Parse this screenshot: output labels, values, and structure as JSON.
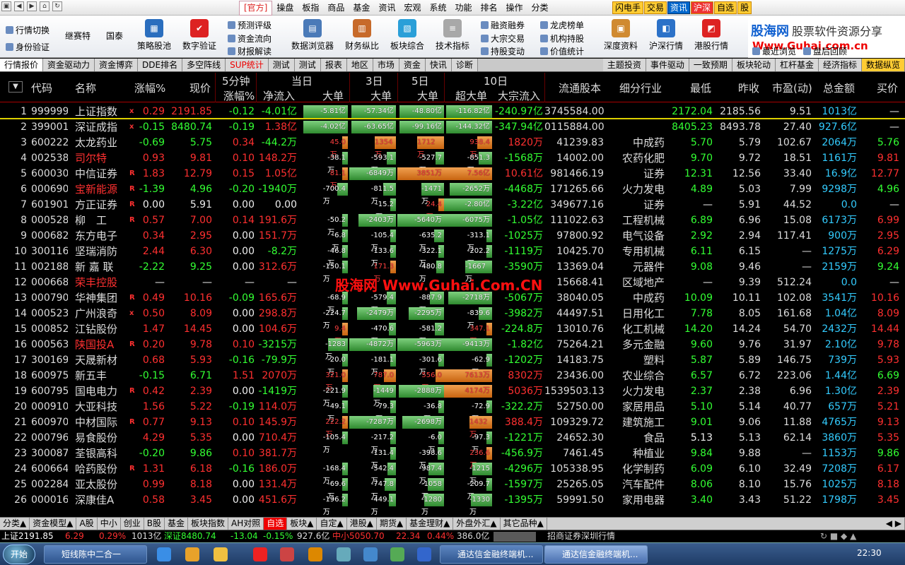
{
  "menu": {
    "official": "[官方]",
    "items": [
      "操盘",
      "板指",
      "商品",
      "基金",
      "资讯",
      "宏观",
      "系统",
      "功能",
      "排名",
      "操作",
      "分类"
    ],
    "right": [
      "闪电手",
      "交易",
      "资讯",
      "沪深",
      "自选",
      "股"
    ]
  },
  "toolbar": {
    "big": [
      "行情切换",
      "身份验证",
      "继赛特",
      "国泰",
      "策略股池",
      "数字验证",
      "数据浏览器",
      "财务纵比",
      "板块综合",
      "技术指标",
      "深度资料",
      "沪深行情",
      "港股行情"
    ],
    "small": [
      "预测评级",
      "资金流向",
      "财报解读",
      "融资融券",
      "大宗交易",
      "持股变动",
      "龙虎榜单",
      "机构持股",
      "价值统计",
      "最近浏览",
      "盘后回顾"
    ]
  },
  "logo": {
    "line1": "股海网",
    "line1b": "股票软件资源分享",
    "line2": "Www.Guhai.com.cn"
  },
  "tabs": [
    "行情报价",
    "资金驱动力",
    "资金博弈",
    "DDE排名",
    "多空阵线",
    "SUP统计",
    "测试",
    "测试",
    "报表",
    "地区",
    "市场",
    "资金",
    "快讯",
    "诊断"
  ],
  "tabs_right": [
    "主题投资",
    "事件驱动",
    "一致预期",
    "板块轮动",
    "杠杆基金",
    "经济指标",
    "数据纵览"
  ],
  "header": {
    "code": "代码",
    "name": "名称",
    "chg": "涨幅%",
    "px": "现价",
    "m5": "5分钟",
    "m5sub": "涨幅%",
    "today": "当日",
    "net": "净流入",
    "big": "大单",
    "d3": "3日",
    "d3big": "大单",
    "d5": "5日",
    "d5big": "大单",
    "d10": "10日",
    "xbig": "超大单",
    "block": "大宗流入",
    "cap": "流通股本",
    "ind": "细分行业",
    "low": "最低",
    "prev": "昨收",
    "pe": "市盈(动)",
    "tot": "总金额",
    "buy": "买价"
  },
  "rows": [
    [
      "1",
      "999999",
      "上证指数",
      "x",
      "0.29",
      "2191.85",
      "-0.12",
      "-4.01亿",
      "-5.81亿",
      "-57.34亿",
      "-48.80亿",
      "-116.82亿",
      "-240.97亿",
      "3745584.00",
      "",
      "2172.04",
      "2185.56",
      "9.51",
      "1013亿",
      "—"
    ],
    [
      "2",
      "399001",
      "深证成指",
      "x",
      "-0.15",
      "8480.74",
      "-0.19",
      "1.38亿",
      "-4.02亿",
      "-63.65亿",
      "-99.16亿",
      "-144.32亿",
      "-347.94亿",
      "0115884.00",
      "",
      "8405.23",
      "8493.78",
      "27.40",
      "927.6亿",
      "—"
    ],
    [
      "3",
      "600222",
      "太龙药业",
      "",
      "-0.69",
      "5.75",
      "0.34",
      "-44.2万",
      "45.0万",
      "1354万",
      "1712万",
      "938.4万",
      "1820万",
      "41239.83",
      "中成药",
      "5.70",
      "5.79",
      "102.67",
      "2064万",
      "5.76"
    ],
    [
      "4",
      "002538",
      "司尔特",
      "",
      "0.93",
      "9.81",
      "0.10",
      "148.2万",
      "-38.1万",
      "-593.1万",
      "-527.7万",
      "-851.3万",
      "-1568万",
      "14002.00",
      "农药化肥",
      "9.70",
      "9.72",
      "18.51",
      "1161万",
      "9.81"
    ],
    [
      "5",
      "600030",
      "中信证券",
      "R",
      "1.83",
      "12.79",
      "0.15",
      "1.05亿",
      "81.1万",
      "-6849万",
      "3851万",
      "7.56亿",
      "10.61亿",
      "981466.19",
      "证券",
      "12.31",
      "12.56",
      "33.40",
      "16.9亿",
      "12.77"
    ],
    [
      "6",
      "000690",
      "宝新能源",
      "R",
      "-1.39",
      "4.96",
      "-0.20",
      "-1940万",
      "-700.4万",
      "-811.5万",
      "-1471万",
      "-2652万",
      "-4468万",
      "171265.66",
      "火力发电",
      "4.89",
      "5.03",
      "7.99",
      "9298万",
      "4.96"
    ],
    [
      "7",
      "601901",
      "方正证券",
      "R",
      "0.00",
      "5.91",
      "0.00",
      "0.00",
      "",
      "-15.2万",
      "24.4万",
      "-2.80亿",
      "-3.22亿",
      "349677.16",
      "证券",
      "—",
      "5.91",
      "44.52",
      "0.0",
      "—"
    ],
    [
      "8",
      "000528",
      "柳　工",
      "R",
      "0.57",
      "7.00",
      "0.14",
      "191.6万",
      "-50.2万",
      "-2403万",
      "-5640万",
      "-6075万",
      "-1.05亿",
      "111022.63",
      "工程机械",
      "6.89",
      "6.96",
      "15.08",
      "6173万",
      "6.99"
    ],
    [
      "9",
      "000682",
      "东方电子",
      "",
      "0.34",
      "2.95",
      "0.00",
      "151.7万",
      "-6.8万",
      "-105.4万",
      "-635.2万",
      "-313.1万",
      "-1025万",
      "97800.92",
      "电气设备",
      "2.92",
      "2.94",
      "117.41",
      "900万",
      "2.95"
    ],
    [
      "10",
      "300116",
      "坚瑞消防",
      "",
      "2.44",
      "6.30",
      "0.00",
      "-8.2万",
      "-46.8万",
      "-133.6万",
      "-322.1万",
      "-202.2万",
      "-1119万",
      "10425.70",
      "专用机械",
      "6.11",
      "6.15",
      "—",
      "1275万",
      "6.29"
    ],
    [
      "11",
      "002188",
      "新 嘉 联",
      "",
      "-2.22",
      "9.25",
      "0.00",
      "312.6万",
      "-150.1万",
      "171.3万",
      "-480.8万",
      "-1667万",
      "-3590万",
      "13369.04",
      "元器件",
      "9.08",
      "9.46",
      "—",
      "2159万",
      "9.24"
    ],
    [
      "12",
      "000668",
      "荣丰控股",
      "",
      "—",
      "—",
      "—",
      "—",
      "",
      "",
      "",
      "",
      "",
      "15668.41",
      "区域地产",
      "—",
      "9.39",
      "512.24",
      "0.0",
      "—"
    ],
    [
      "13",
      "000790",
      "华神集团",
      "R",
      "0.49",
      "10.16",
      "-0.09",
      "165.6万",
      "-68.9万",
      "-579.4万",
      "-887.9万",
      "-2718万",
      "-5067万",
      "38040.05",
      "中成药",
      "10.09",
      "10.11",
      "102.08",
      "3541万",
      "10.16"
    ],
    [
      "14",
      "000523",
      "广州浪奇",
      "x",
      "0.50",
      "8.09",
      "0.00",
      "298.8万",
      "-224.7万",
      "-2479万",
      "-2295万",
      "-839.6万",
      "-3982万",
      "44497.51",
      "日用化工",
      "7.78",
      "8.05",
      "161.68",
      "1.04亿",
      "8.09"
    ],
    [
      "15",
      "000852",
      "江钻股份",
      "",
      "1.47",
      "14.45",
      "0.00",
      "104.6万",
      "9.4万",
      "-470.6万",
      "-581.2万",
      "347.1万",
      "-224.8万",
      "13010.76",
      "化工机械",
      "14.20",
      "14.24",
      "54.70",
      "2432万",
      "14.44"
    ],
    [
      "16",
      "000563",
      "陕国投A",
      "R",
      "0.20",
      "9.78",
      "0.10",
      "-3215万",
      "-1283万",
      "-4872万",
      "-5963万",
      "-9413万",
      "-1.82亿",
      "75264.21",
      "多元金融",
      "9.60",
      "9.76",
      "31.97",
      "2.10亿",
      "9.78"
    ],
    [
      "17",
      "300169",
      "天晟新材",
      "",
      "0.68",
      "5.93",
      "-0.16",
      "-79.9万",
      "-20.0万",
      "-181.1万",
      "-301.6万",
      "-62.9万",
      "-1202万",
      "14183.75",
      "塑料",
      "5.87",
      "5.89",
      "146.75",
      "739万",
      "5.93"
    ],
    [
      "18",
      "600975",
      "新五丰",
      "",
      "-0.15",
      "6.71",
      "1.51",
      "2070万",
      "321.0万",
      "787.0万",
      "556.0万",
      "7613万",
      "8302万",
      "23436.00",
      "农业综合",
      "6.57",
      "6.72",
      "223.06",
      "1.44亿",
      "6.69"
    ],
    [
      "19",
      "600795",
      "国电电力",
      "R",
      "0.42",
      "2.39",
      "0.00",
      "-1419万",
      "-221.9万",
      "-1449万",
      "-2888万",
      "4174万",
      "5036万",
      "1539503.13",
      "火力发电",
      "2.37",
      "2.38",
      "6.96",
      "1.30亿",
      "2.39"
    ],
    [
      "20",
      "000910",
      "大亚科技",
      "",
      "1.56",
      "5.22",
      "-0.19",
      "114.0万",
      "-49.1万",
      "-79.3万",
      "-36.8万",
      "-72.9万",
      "-322.2万",
      "52750.00",
      "家居用品",
      "5.10",
      "5.14",
      "40.77",
      "657万",
      "5.21"
    ],
    [
      "21",
      "600970",
      "中材国际",
      "R",
      "0.77",
      "9.13",
      "0.10",
      "145.9万",
      "222.2万",
      "-7287万",
      "-2698万",
      "1432万",
      "388.4万",
      "109329.72",
      "建筑施工",
      "9.01",
      "9.06",
      "11.88",
      "4765万",
      "9.13"
    ],
    [
      "22",
      "000796",
      "易食股份",
      "",
      "4.29",
      "5.35",
      "0.00",
      "710.4万",
      "-105.4万",
      "-217.2万",
      "-6.0万",
      "-97.3万",
      "-1221万",
      "24652.30",
      "食品",
      "5.13",
      "5.13",
      "62.14",
      "3860万",
      "5.35"
    ],
    [
      "23",
      "300087",
      "荃银高科",
      "",
      "-0.20",
      "9.86",
      "0.10",
      "381.7万",
      "",
      "-131.4万",
      "-398.6万",
      "236.6万",
      "-456.9万",
      "7461.45",
      "种植业",
      "9.84",
      "9.88",
      "—",
      "1153万",
      "9.86"
    ],
    [
      "24",
      "600664",
      "哈药股份",
      "R",
      "1.31",
      "6.18",
      "-0.16",
      "186.0万",
      "-168.4万",
      "-542.4万",
      "-987.4万",
      "-1215万",
      "-4296万",
      "105338.95",
      "化学制药",
      "6.09",
      "6.10",
      "32.49",
      "7208万",
      "6.17"
    ],
    [
      "25",
      "002284",
      "亚太股份",
      "",
      "0.99",
      "8.18",
      "0.00",
      "131.4万",
      "-69.6万",
      "-747.8万",
      "-1058万",
      "-209.7万",
      "-1597万",
      "25265.05",
      "汽车配件",
      "8.06",
      "8.10",
      "15.76",
      "1025万",
      "8.18"
    ],
    [
      "26",
      "000016",
      "深康佳A",
      "",
      "0.58",
      "3.45",
      "0.00",
      "451.6万",
      "-196.2万",
      "-449.1万",
      "-1280万",
      "-1330万",
      "-1395万",
      "59991.50",
      "家用电器",
      "3.40",
      "3.43",
      "51.22",
      "1798万",
      "3.45"
    ]
  ],
  "watermark": "股海网 Www.Guhai.Com.CN",
  "btabs": [
    "分类▲",
    "资金模型▲",
    "A股",
    "中小",
    "创业",
    "B股",
    "基金",
    "板块指数",
    "AH对照",
    "自选",
    "板块▲",
    "自定▲",
    "港股▲",
    "期货▲",
    "基金理财▲",
    "外盘外汇▲",
    "其它品种▲"
  ],
  "status": {
    "sh": "上证2191.85",
    "sh_ch": "6.29",
    "sh_pct": "0.29%",
    "sh_amt": "1013亿",
    "sz": "深证8480.74",
    "sz_ch": "-13.04",
    "sz_pct": "-0.15%",
    "sz_amt": "927.6亿",
    "zx": "中小5050.70",
    "zx_ch": "22.34",
    "zx_pct": "0.44%",
    "zx_amt": "386.0亿",
    "broker": "招商证券深圳行情"
  },
  "taskbar": {
    "start": "开始",
    "items": [
      "短线陈中二合一",
      "通达信金融终端机...",
      "通达信金融终端机..."
    ],
    "time": "22:30"
  }
}
